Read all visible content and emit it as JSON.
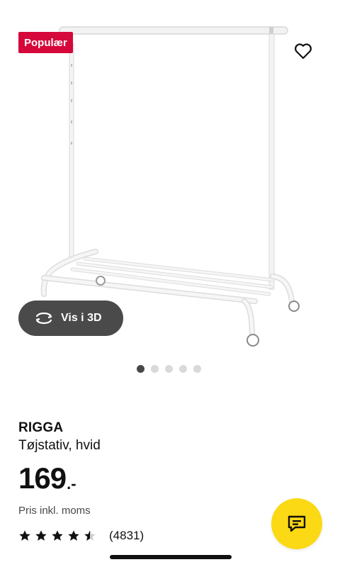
{
  "badge": {
    "label": "Populær",
    "color": "#d6073a"
  },
  "view3d": {
    "label": "Vis i 3D",
    "icon": "rotate-3d-icon"
  },
  "carousel": {
    "count": 5,
    "active": 0
  },
  "product": {
    "name": "RIGGA",
    "description": "Tøjstativ, hvid",
    "price_integer": "169",
    "price_suffix": ".-",
    "price_note": "Pris inkl. moms"
  },
  "rating": {
    "value": 4.5,
    "max": 5,
    "count_label": "(4831)"
  },
  "icons": {
    "favorite": "heart-icon",
    "chat": "chat-icon"
  },
  "colors": {
    "accent_chat": "#fbd914",
    "button_dark": "#4a4a4a"
  }
}
